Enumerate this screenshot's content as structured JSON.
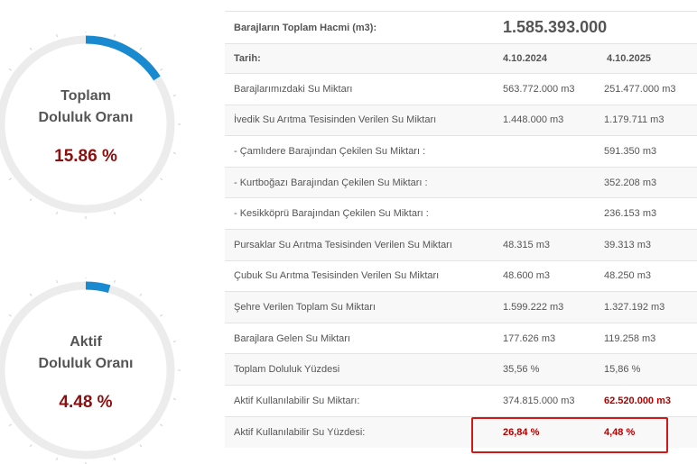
{
  "gauges": [
    {
      "title_line1": "Toplam",
      "title_line2": "Doluluk Oranı",
      "value_text": "15.86 %",
      "fraction": 0.1586,
      "arc_color": "#1a8ad0",
      "track_color": "#ececec"
    },
    {
      "title_line1": "Aktif",
      "title_line2": "Doluluk Oranı",
      "value_text": "4.48 %",
      "fraction": 0.0448,
      "arc_color": "#1a8ad0",
      "track_color": "#ececec"
    }
  ],
  "table": {
    "header": {
      "label": "Barajların Toplam Hacmi (m3):",
      "value": "1.585.393.000"
    },
    "dates": {
      "label": "Tarih:",
      "col1": "4.10.2024",
      "col2": "4.10.2025"
    },
    "rows": [
      {
        "label": "Barajlarımızdaki Su Miktarı",
        "col1": "563.772.000 m3",
        "col2": "251.477.000 m3"
      },
      {
        "label": "İvedik Su Arıtma Tesisinden Verilen Su Miktarı",
        "col1": "1.448.000 m3",
        "col2": "1.179.711 m3"
      },
      {
        "label": "- Çamlıdere Barajından Çekilen Su Miktarı :",
        "col1": "",
        "col2": "591.350 m3"
      },
      {
        "label": "- Kurtboğazı Barajından Çekilen Su Miktarı :",
        "col1": "",
        "col2": "352.208 m3"
      },
      {
        "label": "- Kesikköprü Barajından Çekilen Su Miktarı :",
        "col1": "",
        "col2": "236.153 m3"
      },
      {
        "label": "Pursaklar Su Arıtma Tesisinden Verilen Su Miktarı",
        "col1": "48.315 m3",
        "col2": "39.313 m3"
      },
      {
        "label": "Çubuk Su Arıtma Tesisinden Verilen Su Miktarı",
        "col1": "48.600 m3",
        "col2": "48.250 m3"
      },
      {
        "label": "Şehre Verilen Toplam Su Miktarı",
        "col1": "1.599.222 m3",
        "col2": "1.327.192 m3"
      },
      {
        "label": "Barajlara Gelen Su Miktarı",
        "col1": "177.626 m3",
        "col2": "119.258 m3"
      },
      {
        "label": "Toplam Doluluk Yüzdesi",
        "col1": "35,56 %",
        "col2": "15,86 %"
      },
      {
        "label": "Aktif Kullanılabilir Su Miktarı:",
        "col1": "374.815.000 m3",
        "col2": "62.520.000 m3"
      },
      {
        "label": "Aktif Kullanılabilir Su Yüzdesi:",
        "col1": "26,84 %",
        "col2": "4,48 %"
      }
    ]
  }
}
